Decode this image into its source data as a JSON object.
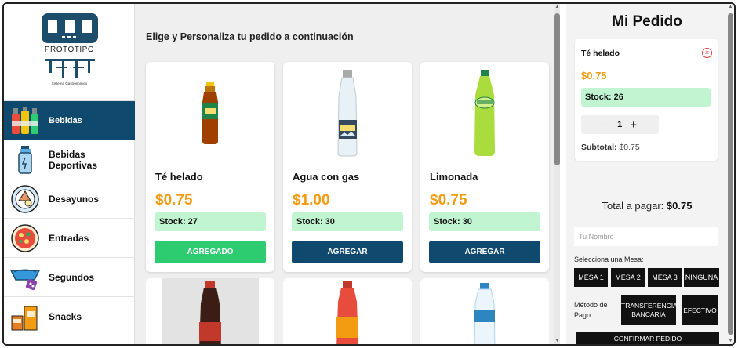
{
  "logo": {
    "brand": "PROTOTIPO",
    "subtitle": "Sistema Gastronómico"
  },
  "sidebar": {
    "items": [
      {
        "label": "Bebidas",
        "icon": "drinks-icon",
        "active": true
      },
      {
        "label": "Bebidas Deportivas",
        "icon": "sports-bottle-icon",
        "active": false
      },
      {
        "label": "Desayunos",
        "icon": "breakfast-icon",
        "active": false
      },
      {
        "label": "Entradas",
        "icon": "starter-plate-icon",
        "active": false
      },
      {
        "label": "Segundos",
        "icon": "main-dish-icon",
        "active": false
      },
      {
        "label": "Snacks",
        "icon": "snacks-icon",
        "active": false
      }
    ]
  },
  "main": {
    "heading": "Elige y Personaliza tu pedido a continuación",
    "products": [
      {
        "name": "Té helado",
        "price": "$0.75",
        "stock": "Stock: 27",
        "button": "AGREGADO",
        "added": true,
        "image": "iced-tea-bottle"
      },
      {
        "name": "Agua con gas",
        "price": "$1.00",
        "stock": "Stock: 30",
        "button": "AGREGAR",
        "added": false,
        "image": "sparkling-water-bottle"
      },
      {
        "name": "Limonada",
        "price": "$0.75",
        "stock": "Stock: 30",
        "button": "AGREGAR",
        "added": false,
        "image": "lemonade-bottle"
      }
    ],
    "next_row_images": [
      "cola-bottle",
      "orange-soda-bottle",
      "water-bottle"
    ]
  },
  "order": {
    "title": "Mi Pedido",
    "item": {
      "name": "Té helado",
      "price": "$0.75",
      "stock": "Stock: 26",
      "quantity": "1",
      "minus": "−",
      "plus": "+",
      "subtotal_label": "Subtotal:",
      "subtotal_value": "$0.75"
    },
    "total_label": "Total a pagar:",
    "total_value": "$0.75",
    "name_placeholder": "Tu Nombre",
    "mesa_label": "Selecciona una Mesa:",
    "mesas": [
      "MESA 1",
      "MESA 2",
      "MESA 3",
      "NINGUNA"
    ],
    "payment_label": "Método de Pago:",
    "payment_options": [
      "TRANSFERENCIA BANCARIA",
      "EFECTIVO"
    ],
    "confirm": "CONFIRMAR PEDIDO"
  },
  "colors": {
    "primary": "#0f4a6e",
    "added": "#2ecc71",
    "price": "#f39c12",
    "stock_bg": "#c1f5d1"
  }
}
